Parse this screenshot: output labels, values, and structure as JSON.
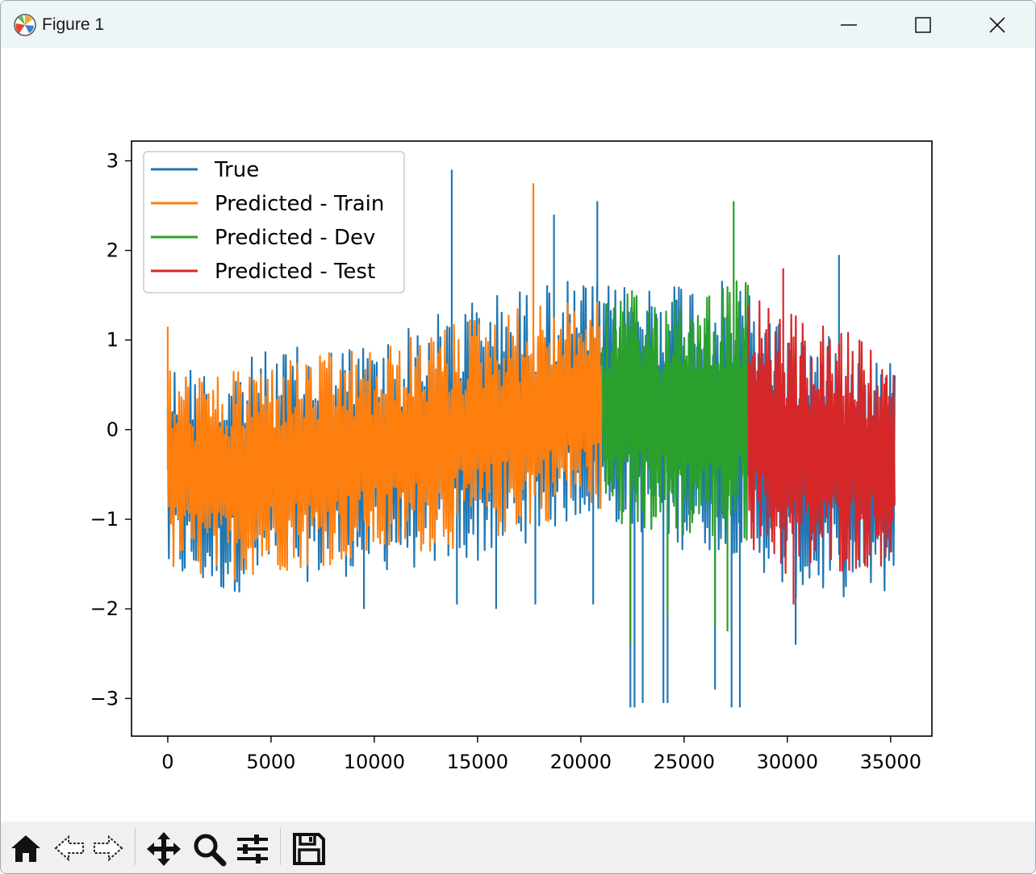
{
  "window": {
    "title": "Figure 1"
  },
  "toolbar": {
    "buttons": [
      {
        "icon": "home-icon",
        "tooltip": "Home"
      },
      {
        "icon": "back-arrow-icon",
        "tooltip": "Back"
      },
      {
        "icon": "forward-arrow-icon",
        "tooltip": "Forward"
      },
      {
        "icon": "pan-icon",
        "tooltip": "Pan"
      },
      {
        "icon": "zoom-icon",
        "tooltip": "Zoom"
      },
      {
        "icon": "subplots-icon",
        "tooltip": "Configure subplots"
      },
      {
        "icon": "save-icon",
        "tooltip": "Save"
      }
    ]
  },
  "chart_data": {
    "type": "line",
    "title": "",
    "xlabel": "",
    "ylabel": "",
    "xlim": [
      -1755,
      37000
    ],
    "ylim": [
      -3.42,
      3.22
    ],
    "xticks": [
      0,
      5000,
      10000,
      15000,
      20000,
      25000,
      30000,
      35000
    ],
    "xtick_labels": [
      "0",
      "5000",
      "10000",
      "15000",
      "20000",
      "25000",
      "30000",
      "35000"
    ],
    "yticks": [
      3,
      2,
      1,
      0,
      -1,
      -2,
      -3
    ],
    "ytick_labels": [
      "3",
      "2",
      "1",
      "0",
      "−1",
      "−2",
      "−3"
    ],
    "grid": false,
    "legend_position": "upper-left",
    "series": [
      {
        "name": "True",
        "color": "#1f77b4",
        "x_range": [
          0,
          35200
        ],
        "envelope": {
          "x": [
            0,
            2500,
            5000,
            10000,
            15000,
            20000,
            21000,
            25000,
            28000,
            30000,
            35200
          ],
          "low": [
            -1.7,
            -1.85,
            -1.75,
            -1.6,
            -1.5,
            -1.0,
            -1.0,
            -1.35,
            -1.4,
            -1.9,
            -1.85
          ],
          "high": [
            0.8,
            0.7,
            0.9,
            1.0,
            1.5,
            1.7,
            1.6,
            1.75,
            1.6,
            1.2,
            0.8
          ]
        },
        "extremes": [
          {
            "x": 13750,
            "y": 2.9
          },
          {
            "x": 20800,
            "y": 2.55
          },
          {
            "x": 18700,
            "y": 2.4
          },
          {
            "x": 22400,
            "y": -3.1
          },
          {
            "x": 22600,
            "y": -3.1
          },
          {
            "x": 23000,
            "y": -3.05
          },
          {
            "x": 24000,
            "y": -3.05
          },
          {
            "x": 24200,
            "y": -3.05
          },
          {
            "x": 26500,
            "y": -2.9
          },
          {
            "x": 27300,
            "y": -3.1
          },
          {
            "x": 27700,
            "y": -3.1
          },
          {
            "x": 30400,
            "y": -2.4
          },
          {
            "x": 9500,
            "y": -2.0
          },
          {
            "x": 14000,
            "y": -1.95
          },
          {
            "x": 15900,
            "y": -2.0
          },
          {
            "x": 17800,
            "y": -1.95
          },
          {
            "x": 20600,
            "y": -1.95
          },
          {
            "x": 32500,
            "y": 1.95
          }
        ]
      },
      {
        "name": "Predicted - Train",
        "color": "#ff7f0e",
        "x_range": [
          0,
          21050
        ],
        "envelope": {
          "x": [
            0,
            2500,
            5000,
            10000,
            15000,
            20000,
            21050
          ],
          "low": [
            -1.6,
            -1.7,
            -1.6,
            -1.45,
            -1.3,
            -0.9,
            -0.9
          ],
          "high": [
            0.7,
            0.6,
            0.8,
            0.9,
            1.3,
            1.5,
            1.4
          ]
        },
        "extremes": [
          {
            "x": 17700,
            "y": 2.75
          },
          {
            "x": 0,
            "y": 1.15
          }
        ]
      },
      {
        "name": "Predicted - Dev",
        "color": "#2ca02c",
        "x_range": [
          21050,
          28100
        ],
        "envelope": {
          "x": [
            21050,
            24000,
            28100
          ],
          "low": [
            -1.1,
            -1.2,
            -1.3
          ],
          "high": [
            1.5,
            1.6,
            1.7
          ]
        },
        "extremes": [
          {
            "x": 27400,
            "y": 2.55
          },
          {
            "x": 22400,
            "y": -2.4
          },
          {
            "x": 24200,
            "y": -2.1
          },
          {
            "x": 26500,
            "y": -2.2
          },
          {
            "x": 27100,
            "y": -2.25
          }
        ]
      },
      {
        "name": "Predicted - Test",
        "color": "#d62728",
        "x_range": [
          28100,
          35200
        ],
        "envelope": {
          "x": [
            28100,
            30000,
            33000,
            35200
          ],
          "low": [
            -1.3,
            -1.7,
            -1.6,
            -1.5
          ],
          "high": [
            1.5,
            1.3,
            1.1,
            0.7
          ]
        },
        "extremes": [
          {
            "x": 29800,
            "y": 1.8
          },
          {
            "x": 30300,
            "y": -1.95
          }
        ]
      }
    ]
  }
}
